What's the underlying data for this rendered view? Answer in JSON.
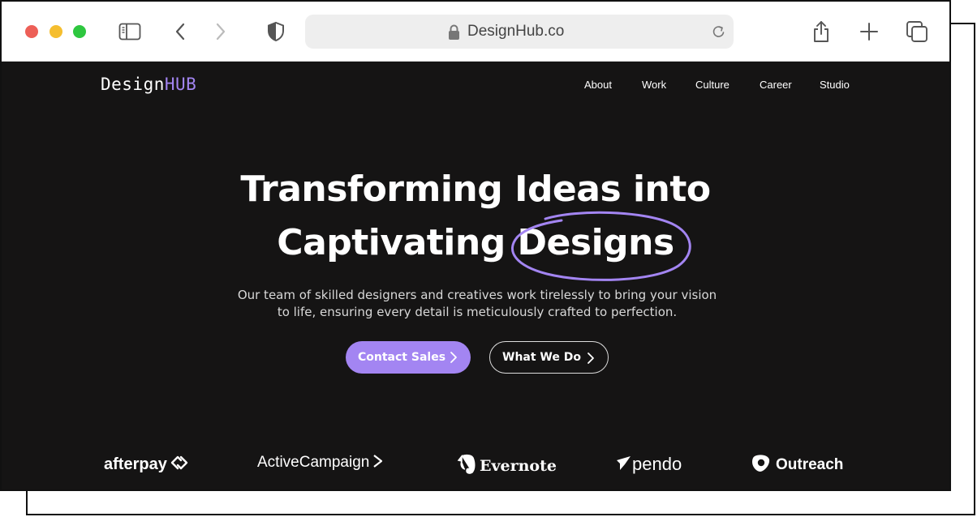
{
  "browser": {
    "url": "DesignHub.co",
    "icons": [
      "sidebar-icon",
      "back-icon",
      "forward-icon",
      "shield-icon",
      "lock-icon",
      "reload-icon",
      "share-icon",
      "new-tab-icon",
      "tabs-overview-icon"
    ]
  },
  "site": {
    "logo_main": "Design",
    "logo_accent": "HUB",
    "nav": [
      "About",
      "Work",
      "Culture",
      "Career",
      "Studio"
    ],
    "hero": {
      "line1": "Transforming Ideas into",
      "line2_prefix": "Captivating",
      "line2_highlight": "Designs",
      "subtitle_line1": "Our team of skilled designers and creatives work tirelessly to bring your vision",
      "subtitle_line2": "to life, ensuring every detail is meticulously crafted to perfection."
    },
    "buttons": {
      "primary": "Contact Sales",
      "secondary": "What We Do"
    },
    "brands": [
      "afterpay",
      "ActiveCampaign",
      "Evernote",
      "pendo",
      "Outreach"
    ]
  },
  "colors": {
    "accent": "#a385f2",
    "background": "#151414",
    "text": "#ffffff"
  }
}
